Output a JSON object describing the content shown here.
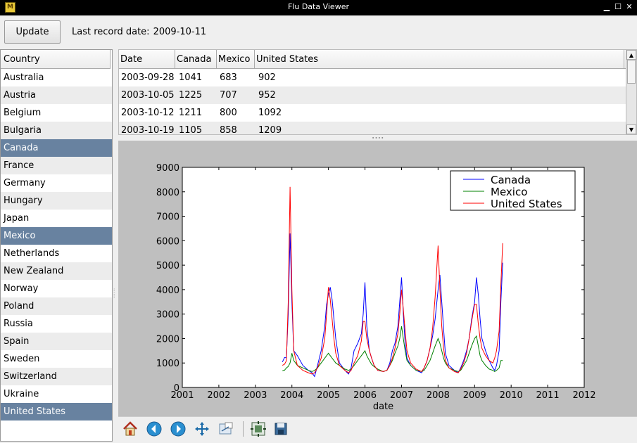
{
  "window": {
    "title": "Flu Data Viewer",
    "icon": "app-icon"
  },
  "toolbar_top": {
    "update_label": "Update",
    "last_record_label": "Last record date:",
    "last_record_value": "2009-10-11"
  },
  "country_list": {
    "header": "Country",
    "items": [
      {
        "label": "Australia",
        "selected": false
      },
      {
        "label": "Austria",
        "selected": false
      },
      {
        "label": "Belgium",
        "selected": false
      },
      {
        "label": "Bulgaria",
        "selected": false
      },
      {
        "label": "Canada",
        "selected": true
      },
      {
        "label": "France",
        "selected": false
      },
      {
        "label": "Germany",
        "selected": false
      },
      {
        "label": "Hungary",
        "selected": false
      },
      {
        "label": "Japan",
        "selected": false
      },
      {
        "label": "Mexico",
        "selected": true
      },
      {
        "label": "Netherlands",
        "selected": false
      },
      {
        "label": "New Zealand",
        "selected": false
      },
      {
        "label": "Norway",
        "selected": false
      },
      {
        "label": "Poland",
        "selected": false
      },
      {
        "label": "Russia",
        "selected": false
      },
      {
        "label": "Spain",
        "selected": false
      },
      {
        "label": "Sweden",
        "selected": false
      },
      {
        "label": "Switzerland",
        "selected": false
      },
      {
        "label": "Ukraine",
        "selected": false
      },
      {
        "label": "United States",
        "selected": true
      }
    ],
    "selected_color": "#6882a0"
  },
  "data_table": {
    "headers": [
      "Date",
      "Canada",
      "Mexico",
      "United States"
    ],
    "rows": [
      [
        "2003-09-28",
        "1041",
        "683",
        "902"
      ],
      [
        "2003-10-05",
        "1225",
        "707",
        "952"
      ],
      [
        "2003-10-12",
        "1211",
        "800",
        "1092"
      ],
      [
        "2003-10-19",
        "1105",
        "858",
        "1209"
      ]
    ]
  },
  "chart_data": {
    "type": "line",
    "xlabel": "date",
    "ylabel": "",
    "xlim": [
      2001,
      2012
    ],
    "ylim": [
      0,
      9000
    ],
    "x_ticks": [
      "2001",
      "2002",
      "2003",
      "2004",
      "2005",
      "2006",
      "2007",
      "2008",
      "2009",
      "2010",
      "2011",
      "2012"
    ],
    "y_ticks": [
      "0",
      "1000",
      "2000",
      "3000",
      "4000",
      "5000",
      "6000",
      "7000",
      "8000",
      "9000"
    ],
    "legend_position": "top-right",
    "grid": false,
    "series": [
      {
        "name": "Canada",
        "color": "#0000ff",
        "x": [
          2003.74,
          2003.8,
          2003.85,
          2003.9,
          2003.95,
          2004.0,
          2004.05,
          2004.15,
          2004.3,
          2004.45,
          2004.55,
          2004.62,
          2004.7,
          2004.8,
          2004.9,
          2004.95,
          2005.0,
          2005.05,
          2005.1,
          2005.15,
          2005.2,
          2005.3,
          2005.45,
          2005.55,
          2005.62,
          2005.7,
          2005.8,
          2005.9,
          2005.95,
          2006.0,
          2006.05,
          2006.12,
          2006.18,
          2006.25,
          2006.35,
          2006.5,
          2006.6,
          2006.68,
          2006.75,
          2006.82,
          2006.9,
          2006.95,
          2007.0,
          2007.05,
          2007.1,
          2007.15,
          2007.25,
          2007.4,
          2007.55,
          2007.62,
          2007.7,
          2007.78,
          2007.85,
          2007.92,
          2008.0,
          2008.05,
          2008.1,
          2008.15,
          2008.2,
          2008.3,
          2008.45,
          2008.55,
          2008.62,
          2008.7,
          2008.78,
          2008.85,
          2008.92,
          2009.0,
          2009.05,
          2009.1,
          2009.15,
          2009.2,
          2009.3,
          2009.4,
          2009.5,
          2009.55,
          2009.6,
          2009.67,
          2009.72,
          2009.77
        ],
        "y": [
          1041,
          1225,
          1211,
          3000,
          6300,
          3500,
          1500,
          1300,
          900,
          700,
          600,
          450,
          900,
          1500,
          2500,
          3400,
          3800,
          4100,
          3600,
          2800,
          2000,
          1000,
          700,
          550,
          800,
          1500,
          1800,
          2200,
          3000,
          4300,
          2500,
          1500,
          1200,
          900,
          700,
          650,
          700,
          1000,
          1500,
          1800,
          2500,
          3500,
          4500,
          3000,
          1800,
          1200,
          900,
          700,
          600,
          800,
          1100,
          1600,
          2100,
          2800,
          4000,
          4600,
          3500,
          2400,
          1400,
          900,
          700,
          600,
          800,
          1100,
          1500,
          2000,
          2800,
          3500,
          4500,
          3800,
          2800,
          2000,
          1500,
          1100,
          800,
          700,
          900,
          1500,
          3500,
          5100
        ]
      },
      {
        "name": "Mexico",
        "color": "#008000",
        "x": [
          2003.74,
          2003.8,
          2003.85,
          2003.9,
          2003.95,
          2004.0,
          2004.05,
          2004.15,
          2004.3,
          2004.45,
          2004.55,
          2004.62,
          2004.7,
          2004.8,
          2004.9,
          2004.95,
          2005.0,
          2005.05,
          2005.1,
          2005.15,
          2005.2,
          2005.3,
          2005.45,
          2005.55,
          2005.62,
          2005.7,
          2005.8,
          2005.9,
          2005.95,
          2006.0,
          2006.05,
          2006.12,
          2006.18,
          2006.25,
          2006.35,
          2006.5,
          2006.6,
          2006.68,
          2006.75,
          2006.82,
          2006.9,
          2006.95,
          2007.0,
          2007.05,
          2007.1,
          2007.15,
          2007.25,
          2007.4,
          2007.55,
          2007.62,
          2007.7,
          2007.78,
          2007.85,
          2007.92,
          2008.0,
          2008.05,
          2008.1,
          2008.15,
          2008.2,
          2008.3,
          2008.45,
          2008.55,
          2008.62,
          2008.7,
          2008.78,
          2008.85,
          2008.92,
          2009.0,
          2009.05,
          2009.1,
          2009.15,
          2009.2,
          2009.3,
          2009.4,
          2009.5,
          2009.55,
          2009.6,
          2009.67,
          2009.72,
          2009.77
        ],
        "y": [
          683,
          707,
          800,
          858,
          1000,
          1400,
          1100,
          900,
          800,
          700,
          650,
          700,
          800,
          1000,
          1200,
          1300,
          1400,
          1300,
          1200,
          1100,
          1000,
          900,
          750,
          700,
          750,
          900,
          1100,
          1300,
          1400,
          1500,
          1300,
          1100,
          950,
          850,
          750,
          650,
          700,
          900,
          1100,
          1400,
          1700,
          2000,
          2500,
          2000,
          1500,
          1100,
          900,
          700,
          650,
          700,
          900,
          1100,
          1400,
          1700,
          2000,
          1800,
          1500,
          1200,
          1000,
          800,
          700,
          650,
          700,
          900,
          1100,
          1400,
          1700,
          2000,
          2100,
          1700,
          1300,
          1100,
          900,
          750,
          700,
          650,
          700,
          800,
          1100,
          1100
        ]
      },
      {
        "name": "United States",
        "color": "#ff0000",
        "x": [
          2003.74,
          2003.8,
          2003.85,
          2003.9,
          2003.95,
          2004.0,
          2004.05,
          2004.15,
          2004.3,
          2004.45,
          2004.55,
          2004.62,
          2004.7,
          2004.8,
          2004.9,
          2004.95,
          2005.0,
          2005.05,
          2005.1,
          2005.15,
          2005.2,
          2005.3,
          2005.45,
          2005.55,
          2005.62,
          2005.7,
          2005.8,
          2005.9,
          2005.95,
          2006.0,
          2006.05,
          2006.12,
          2006.18,
          2006.25,
          2006.35,
          2006.5,
          2006.6,
          2006.68,
          2006.75,
          2006.82,
          2006.9,
          2006.95,
          2007.0,
          2007.05,
          2007.1,
          2007.15,
          2007.25,
          2007.4,
          2007.55,
          2007.62,
          2007.7,
          2007.78,
          2007.85,
          2007.92,
          2008.0,
          2008.05,
          2008.1,
          2008.15,
          2008.2,
          2008.3,
          2008.45,
          2008.55,
          2008.62,
          2008.7,
          2008.78,
          2008.85,
          2008.92,
          2009.0,
          2009.05,
          2009.1,
          2009.15,
          2009.2,
          2009.3,
          2009.4,
          2009.5,
          2009.55,
          2009.6,
          2009.67,
          2009.72,
          2009.77
        ],
        "y": [
          902,
          952,
          1092,
          3500,
          8200,
          4000,
          1500,
          900,
          700,
          600,
          550,
          600,
          800,
          1200,
          2000,
          3000,
          4100,
          3600,
          2800,
          2000,
          1400,
          900,
          700,
          600,
          700,
          1000,
          1300,
          1900,
          2700,
          2700,
          2000,
          1500,
          1200,
          900,
          700,
          650,
          700,
          900,
          1200,
          1600,
          2200,
          3000,
          4000,
          3200,
          2300,
          1500,
          1000,
          750,
          650,
          800,
          1100,
          1600,
          2400,
          3700,
          5800,
          4000,
          2500,
          1600,
          1100,
          800,
          650,
          600,
          750,
          1000,
          1400,
          2000,
          2700,
          3400,
          3400,
          2600,
          2000,
          1600,
          1300,
          1100,
          1000,
          1200,
          1500,
          2300,
          4200,
          5900
        ]
      }
    ]
  },
  "plot_toolbar": {
    "icons": [
      "home-icon",
      "back-icon",
      "forward-icon",
      "pan-icon",
      "zoom-icon",
      "configure-subplots-icon",
      "save-icon"
    ]
  }
}
